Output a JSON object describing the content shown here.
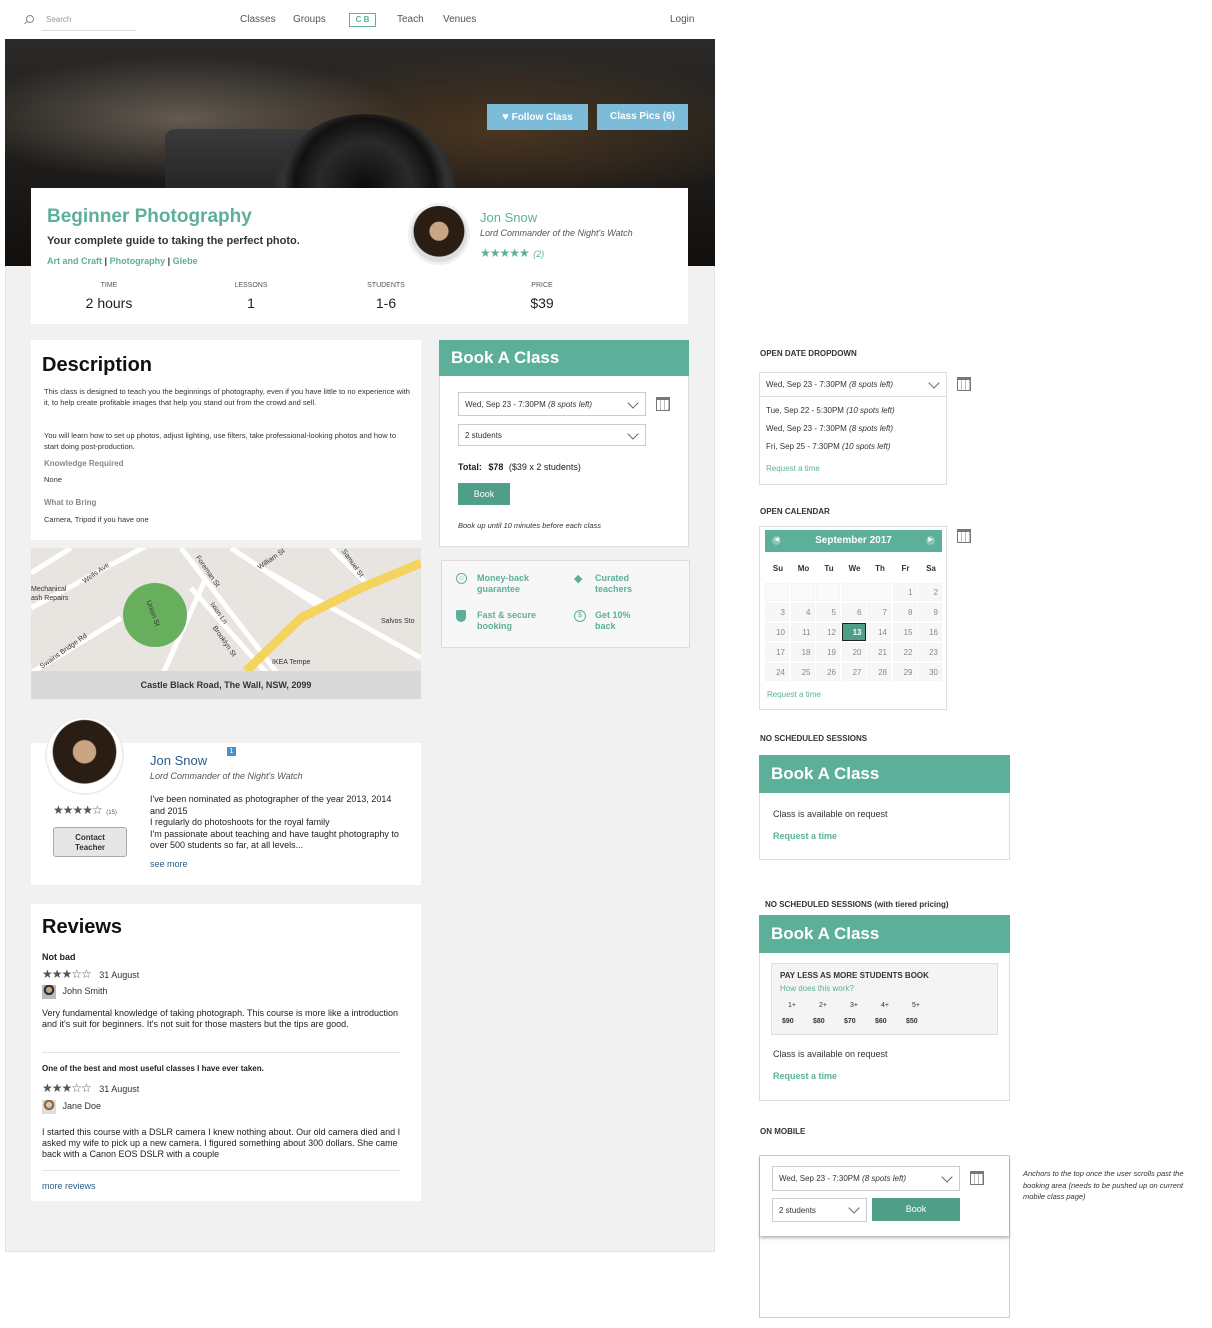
{
  "nav": {
    "search_placeholder": "Search",
    "links": [
      "Classes",
      "Groups",
      "Teach",
      "Venues"
    ],
    "logo": "C B",
    "login": "Login"
  },
  "hero": {
    "follow_label": "Follow Class",
    "pics_label": "Class Pics (6)"
  },
  "class": {
    "title": "Beginner Photography",
    "subtitle": "Your complete guide to taking the perfect photo.",
    "categories": [
      "Art and Craft",
      "Photography",
      "Glebe"
    ],
    "stats": [
      {
        "label": "TIME",
        "value": "2 hours"
      },
      {
        "label": "LESSONS",
        "value": "1"
      },
      {
        "label": "STUDENTS",
        "value": "1-6"
      },
      {
        "label": "PRICE",
        "value": "$39"
      }
    ]
  },
  "teacher": {
    "name": "Jon Snow",
    "title": "Lord Commander of the Night's Watch",
    "rating_count": "(2)",
    "rating_count_2": "(15)",
    "bio": [
      "I've been nominated as photographer of the year 2013, 2014 and 2015",
      "I regularly do photoshoots for the royal family",
      "I'm passionate about teaching and have taught photography to over 500 students so far, at all levels..."
    ],
    "see_more": "see more",
    "contact_label": "Contact Teacher",
    "badge": "1"
  },
  "description": {
    "heading": "Description",
    "p1": "This class is designed to teach you the beginnings of photography, even if you have little to no experience with it, to help create profitable images that help you stand out from the crowd and sell.",
    "p2": "You will learn how to set up photos, adjust lighting, use filters, take professional-looking photos and how to start doing post-production.",
    "knowledge_label": "Knowledge Required",
    "knowledge_value": "None",
    "bring_label": "What to Bring",
    "bring_value": "Camera, Tripod if you have one"
  },
  "map": {
    "streets": [
      "Wells Ave",
      "Foreman St",
      "William St",
      "Samuel St",
      "Union St",
      "Ixion Ln",
      "Brooklyn St",
      "Princes Hwy",
      "Swains Bridge Rd",
      "Stanmore Rd"
    ],
    "places": [
      "Mechanical",
      "ash Repairs",
      "Salvos Sto",
      "IKEA Tempe"
    ],
    "address": "Castle Black Road, The Wall, NSW, 2099"
  },
  "booking": {
    "header": "Book A Class",
    "date_value": "Wed, Sep 23 - 7:30PM",
    "date_spots": "(8 spots left)",
    "students_value": "2 students",
    "total_label": "Total:",
    "total_value": "$78",
    "total_detail": "($39 x 2 students)",
    "book_label": "Book",
    "note": "Book up until 10 minutes before each class"
  },
  "features": [
    {
      "icon": "smile-icon",
      "text": "Money-back guarantee"
    },
    {
      "icon": "diamond-icon",
      "text": "Curated teachers"
    },
    {
      "icon": "shield-icon",
      "text": "Fast & secure booking"
    },
    {
      "icon": "dollar-icon",
      "text": "Get 10% back"
    }
  ],
  "reviews": {
    "heading": "Reviews",
    "items": [
      {
        "title": "Not bad",
        "date": "31 August",
        "author": "John Smith",
        "body": "Very fundamental knowledge of taking photograph. This course is more like a introduction and it's suit for beginners. It's not suit for those masters but the tips are good.",
        "stars": 3
      },
      {
        "title": "One of the best and most useful classes I have ever taken.",
        "date": "31 August",
        "author": "Jane Doe",
        "body": "I started this course with a DSLR camera I knew nothing about. Our old camera died and I asked my wife to pick up a new camera. I figured something about 300 dollars. She came back with a Canon EOS DSLR with a couple",
        "stars": 3
      }
    ],
    "more": "more reviews"
  },
  "variants": {
    "open_date_label": "OPEN DATE DROPDOWN",
    "dropdown_selected": "Wed, Sep 23 - 7:30PM",
    "dropdown_selected_spots": "(8 spots left)",
    "dropdown_options": [
      {
        "date": "Tue, Sep 22 - 5:30PM",
        "spots": "(10 spots left)"
      },
      {
        "date": "Wed, Sep 23 - 7:30PM",
        "spots": "(8 spots left)"
      },
      {
        "date": "Fri, Sep 25 - 7:30PM",
        "spots": "(10 spots left)"
      }
    ],
    "request_time": "Request a time",
    "open_calendar_label": "OPEN CALENDAR",
    "calendar_month": "September 2017",
    "calendar_dow": [
      "Su",
      "Mo",
      "Tu",
      "We",
      "Th",
      "Fr",
      "Sa"
    ],
    "calendar_rows": [
      [
        "",
        "",
        "",
        "",
        "",
        "1",
        "2"
      ],
      [
        "3",
        "4",
        "5",
        "6",
        "7",
        "8",
        "9"
      ],
      [
        "10",
        "11",
        "12",
        "13",
        "14",
        "15",
        "16"
      ],
      [
        "17",
        "18",
        "19",
        "20",
        "21",
        "22",
        "23"
      ],
      [
        "24",
        "25",
        "26",
        "27",
        "28",
        "29",
        "30"
      ]
    ],
    "calendar_selected": "13",
    "no_sessions_label": "NO SCHEDULED SESSIONS",
    "available_on_request": "Class is available on request",
    "request_a_time": "Request a time",
    "tiered_label": "NO SCHEDULED SESSIONS (with tiered pricing)",
    "tier_heading": "PAY LESS AS MORE STUDENTS BOOK",
    "tier_link": "How does this work?",
    "tiers": [
      {
        "students": "1+",
        "price": "$90"
      },
      {
        "students": "2+",
        "price": "$80"
      },
      {
        "students": "3+",
        "price": "$70"
      },
      {
        "students": "4+",
        "price": "$60"
      },
      {
        "students": "5+",
        "price": "$50"
      }
    ],
    "mobile_label": "ON MOBILE",
    "mobile_note": "Anchors to the top once the user scrolls past the booking area (needs to be pushed up on current mobile class page)"
  }
}
